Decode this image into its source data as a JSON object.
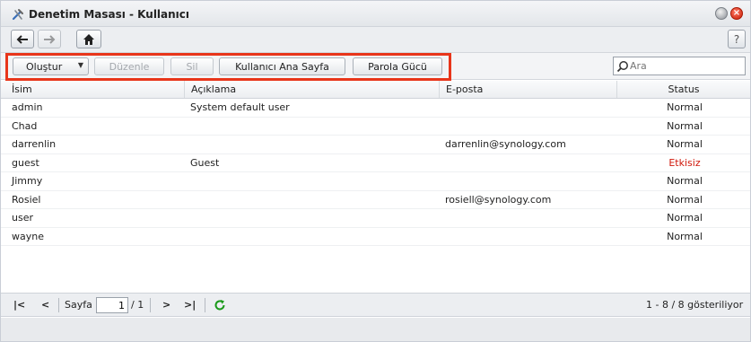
{
  "window": {
    "title": "Denetim Masası - Kullanıcı"
  },
  "nav": {
    "help_label": "?"
  },
  "toolbar": {
    "create_label": "Oluştur",
    "edit_label": "Düzenle",
    "delete_label": "Sil",
    "user_home_label": "Kullanıcı Ana Sayfa",
    "password_strength_label": "Parola Gücü"
  },
  "search": {
    "placeholder": "Ara",
    "value": ""
  },
  "grid": {
    "columns": [
      "İsim",
      "Açıklama",
      "E-posta",
      "Status"
    ],
    "rows": [
      {
        "name": "admin",
        "description": "System default user",
        "email": "",
        "status": "Normal"
      },
      {
        "name": "Chad",
        "description": "",
        "email": "",
        "status": "Normal"
      },
      {
        "name": "darrenlin",
        "description": "",
        "email": "darrenlin@synology.com",
        "status": "Normal"
      },
      {
        "name": "guest",
        "description": "Guest",
        "email": "",
        "status": "Etkisiz"
      },
      {
        "name": "Jimmy",
        "description": "",
        "email": "",
        "status": "Normal"
      },
      {
        "name": "Rosiel",
        "description": "",
        "email": "rosiell@synology.com",
        "status": "Normal"
      },
      {
        "name": "user",
        "description": "",
        "email": "",
        "status": "Normal"
      },
      {
        "name": "wayne",
        "description": "",
        "email": "",
        "status": "Normal"
      }
    ]
  },
  "pager": {
    "page_label": "Sayfa",
    "current_page": "1",
    "total_pages": "/ 1",
    "summary": "1 - 8 / 8 gösteriliyor"
  },
  "colors": {
    "highlight": "#e8351a",
    "disabled_status": "#d0180b"
  }
}
